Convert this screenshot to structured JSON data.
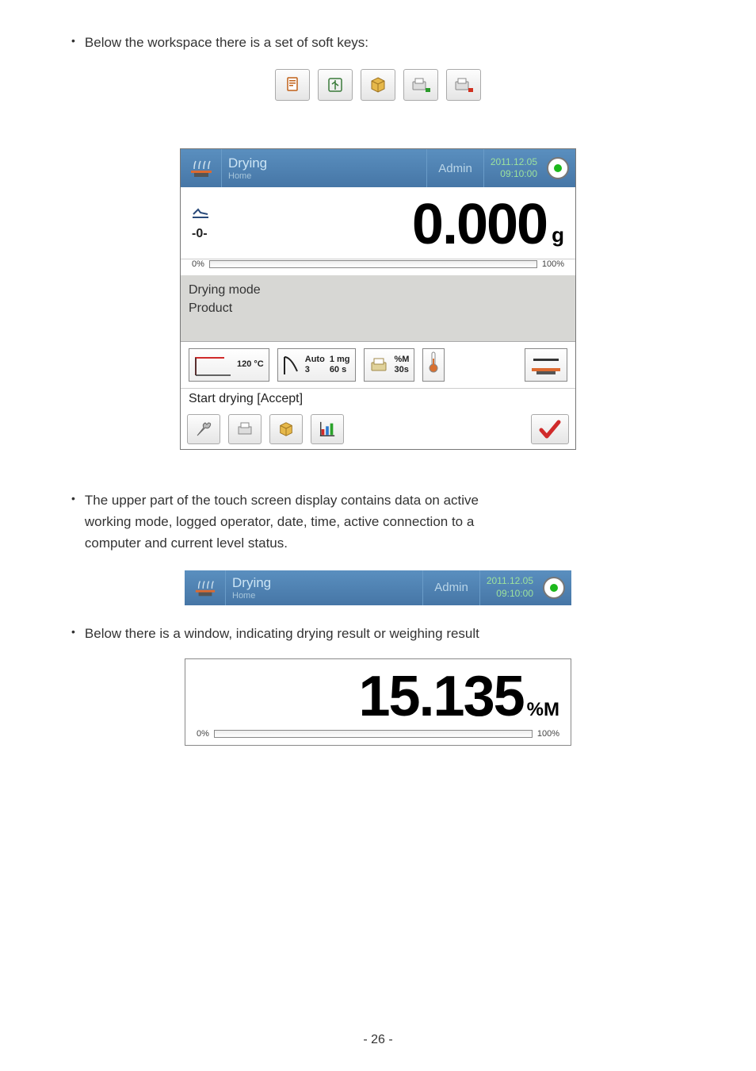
{
  "intro_bullet": "Below the workspace there is a set of soft keys:",
  "screen": {
    "mode_title": "Drying",
    "mode_sub": "Home",
    "user": "Admin",
    "date": "2011.12.05",
    "time": "09:10:00",
    "zero_label": "-0-",
    "value": "0.000",
    "unit": "g",
    "progress_left": "0%",
    "progress_right": "100%",
    "mode_line1": "Drying mode",
    "mode_line2": "Product",
    "temp_value": "120 °C",
    "auto_label": "Auto",
    "auto_sub": "3",
    "mg_label": "1 mg",
    "sec_label": "60 s",
    "pct_m": "%M",
    "interval": "30s",
    "status": "Start drying [Accept]"
  },
  "para2_l1": "The upper part of the touch screen display contains data on active",
  "para2_l2": "working mode, logged operator, date, time, active connection to a",
  "para2_l3": "computer and current level status.",
  "mini_bar": {
    "title": "Drying",
    "sub": "Home",
    "user": "Admin",
    "date": "2011.12.05",
    "time": "09:10:00"
  },
  "para3": "Below there is a window, indicating drying result or weighing result",
  "result": {
    "value": "15.135",
    "unit": "%M",
    "left": "0%",
    "right": "100%"
  },
  "page_number": "- 26 -"
}
